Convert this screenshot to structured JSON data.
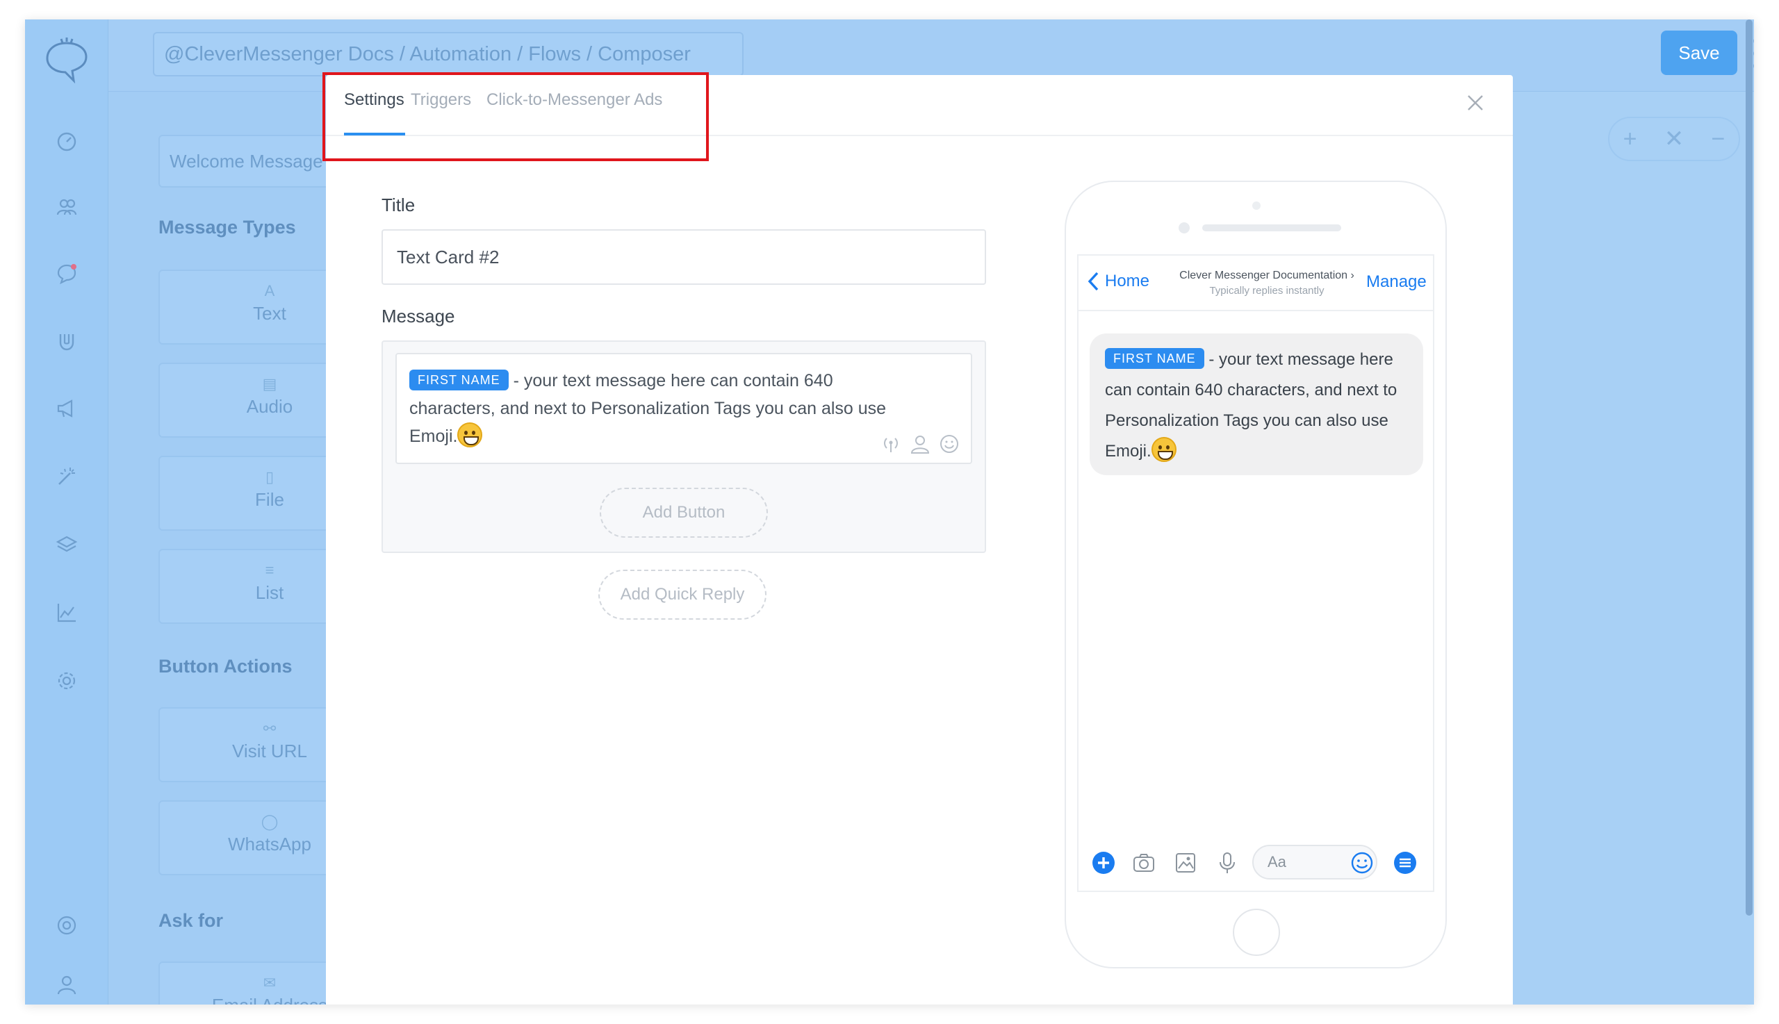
{
  "header": {
    "breadcrumb": "@CleverMessenger Docs  /  Automation  /  Flows  /  Composer",
    "save_label": "Save"
  },
  "panel": {
    "welcome_label": "Welcome Message",
    "message_types_heading": "Message Types",
    "message_types": [
      "Text",
      "Audio",
      "File",
      "List"
    ],
    "button_actions_heading": "Button Actions",
    "button_actions": [
      "Visit URL",
      "WhatsApp"
    ],
    "ask_for_heading": "Ask for",
    "ask_for": [
      "Email Address"
    ]
  },
  "modal": {
    "tabs": [
      "Settings",
      "Triggers",
      "Click-to-Messenger Ads"
    ],
    "active_tab": "Settings",
    "title_label": "Title",
    "title_value": "Text Card #2",
    "message_label": "Message",
    "tag_label": "FIRST NAME",
    "message_text": " - your text message here can contain 640 characters, and next to Personalization Tags you can also use Emoji.",
    "add_button_label": "Add Button",
    "add_quick_reply_label": "Add Quick Reply"
  },
  "preview": {
    "home_label": "Home",
    "page_name": "Clever Messenger Documentation",
    "page_sub": "Typically replies instantly",
    "manage_label": "Manage",
    "tag_label": "FIRST NAME",
    "message_text": " - your text message here can contain 640 characters, and next to Personalization Tags you can also use Emoji.",
    "composer_placeholder": "Aa"
  },
  "colors": {
    "accent": "#2c8cf0",
    "highlight": "#e0161c",
    "overlay": "#a8d0f5"
  }
}
